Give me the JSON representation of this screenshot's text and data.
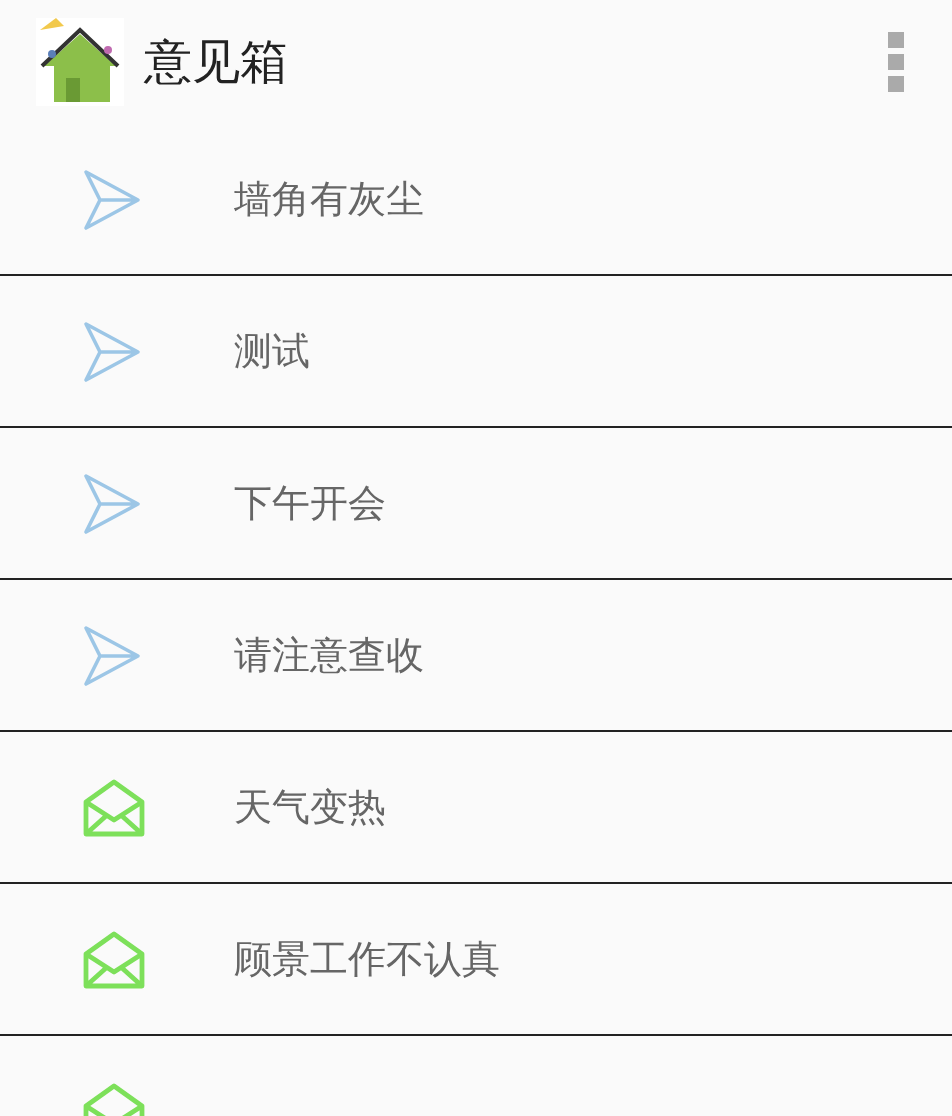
{
  "app_bar": {
    "title": "意见箱"
  },
  "items": [
    {
      "text": "墙角有灰尘",
      "kind": "sent"
    },
    {
      "text": "测试",
      "kind": "sent"
    },
    {
      "text": "下午开会",
      "kind": "sent"
    },
    {
      "text": "请注意查收",
      "kind": "sent"
    },
    {
      "text": "天气变热",
      "kind": "read"
    },
    {
      "text": "顾景工作不认真",
      "kind": "read"
    },
    {
      "kind": "read"
    }
  ]
}
